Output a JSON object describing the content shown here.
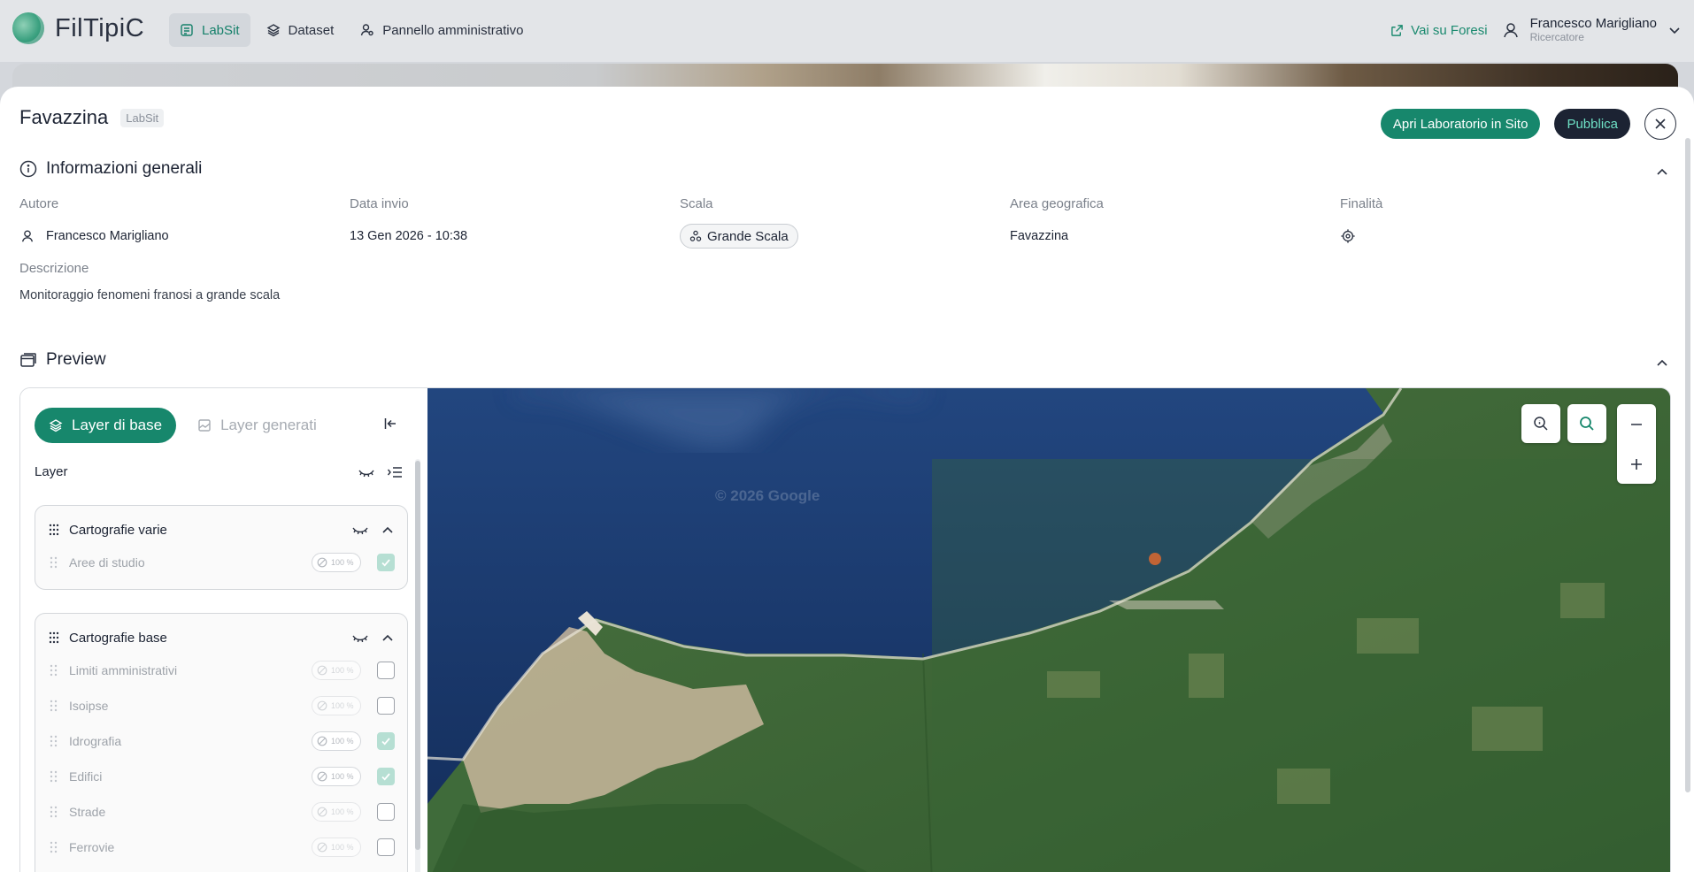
{
  "app": {
    "name": "FilTipiC"
  },
  "nav": {
    "items": [
      {
        "label": "LabSit",
        "active": true
      },
      {
        "label": "Dataset",
        "active": false
      },
      {
        "label": "Pannello amministrativo",
        "active": false
      }
    ]
  },
  "topright": {
    "external_link": "Vai su Foresi",
    "user_name": "Francesco Marigliano",
    "user_role": "Ricercatore"
  },
  "modal": {
    "title": "Favazzina",
    "tag": "LabSit",
    "open_lab_button": "Apri Laboratorio in Sito",
    "publish_button": "Pubblica"
  },
  "general_info": {
    "section_title": "Informazioni generali",
    "fields": {
      "author": {
        "label": "Autore",
        "value": "Francesco Marigliano"
      },
      "date": {
        "label": "Data invio",
        "value": "13 Gen 2026 - 10:38"
      },
      "scale": {
        "label": "Scala",
        "value": "Grande Scala"
      },
      "area": {
        "label": "Area geografica",
        "value": "Favazzina"
      },
      "purpose": {
        "label": "Finalità",
        "icon": "target-icon"
      }
    },
    "description_label": "Descrizione",
    "description_value": "Monitoraggio fenomeni franosi a grande scala"
  },
  "preview": {
    "section_title": "Preview",
    "tabs": {
      "base": "Layer di base",
      "generated": "Layer generati"
    },
    "layer_header": "Layer",
    "groups": [
      {
        "name": "Cartografie varie",
        "layers": [
          {
            "name": "Aree di studio",
            "opacity": "100 %",
            "checked": true
          }
        ]
      },
      {
        "name": "Cartografie base",
        "layers": [
          {
            "name": "Limiti amministrativi",
            "opacity": "100 %",
            "checked": false
          },
          {
            "name": "Isoipse",
            "opacity": "100 %",
            "checked": false
          },
          {
            "name": "Idrografia",
            "opacity": "100 %",
            "checked": true
          },
          {
            "name": "Edifici",
            "opacity": "100 %",
            "checked": true
          },
          {
            "name": "Strade",
            "opacity": "100 %",
            "checked": false
          },
          {
            "name": "Ferrovie",
            "opacity": "100 %",
            "checked": false
          }
        ]
      }
    ],
    "map": {
      "watermark": "© 2026 Google",
      "colors": {
        "sea": "#1c3d74",
        "land": "#3c6b37",
        "town": "#c8b49a",
        "accent": "#17876c"
      }
    }
  }
}
